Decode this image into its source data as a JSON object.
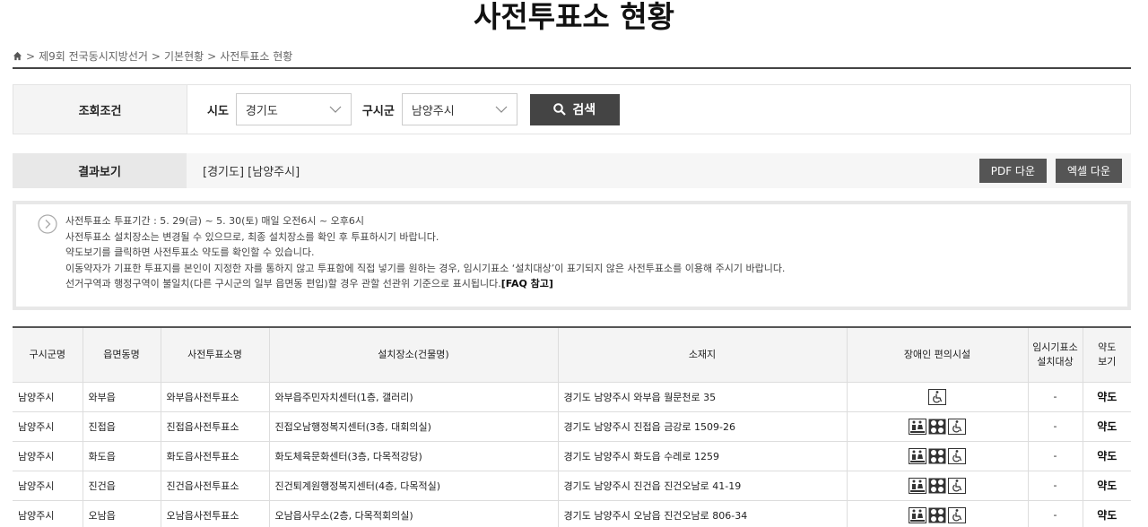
{
  "page": {
    "title": "사전투표소 현황"
  },
  "breadcrumb": {
    "items": [
      "제9회 전국동시지방선거",
      "기본현황",
      "사전투표소 현황"
    ],
    "separator": ">"
  },
  "search": {
    "label": "조회조건",
    "sido_label": "시도",
    "sido_value": "경기도",
    "gusigun_label": "구시군",
    "gusigun_value": "남양주시",
    "button_label": "검색"
  },
  "result": {
    "label": "결과보기",
    "text": "[경기도] [남양주시]",
    "pdf_label": "PDF 다운",
    "excel_label": "엑셀 다운"
  },
  "notice": {
    "line1": "사전투표소 투표기간 : 5. 29(금) ~ 5. 30(토) 매일 오전6시 ~ 오후6시",
    "line2": "사전투표소 설치장소는 변경될 수 있으므로, 최종 설치장소를 확인 후 투표하시기 바랍니다.",
    "line3": "약도보기를 클릭하면 사전투표소 약도를 확인할 수 있습니다.",
    "line4": "이동약자가 기표한 투표지를 본인이 지정한 자를 통하지 않고 투표함에 직접 넣기를 원하는 경우, 임시기표소 ‘설치대상’이 표기되지 않은 사전투표소를 이용해 주시기 바랍니다.",
    "line5": "선거구역과 행정구역이 불일치(다른 구시군의 일부 읍면동 편입)할 경우 관할 선관위 기준으로 표시됩니다.",
    "line5_link": "[FAQ 참고]"
  },
  "table": {
    "headers": {
      "gusigun": "구시군명",
      "eupmyeon": "읍면동명",
      "station": "사전투표소명",
      "place": "설치장소(건물명)",
      "address": "소재지",
      "facilities": "장애인 편의시설",
      "temp1": "임시기표소",
      "temp2": "설치대상",
      "map1": "약도",
      "map2": "보기"
    },
    "rows": [
      {
        "gusigun": "남양주시",
        "eupmyeon": "와부읍",
        "station": "와부읍사전투표소",
        "place": "와부읍주민자치센터(1층, 갤러리)",
        "address": "경기도 남양주시 와부읍 월문천로 35",
        "temp": "-",
        "map": "약도"
      },
      {
        "gusigun": "남양주시",
        "eupmyeon": "진접읍",
        "station": "진접읍사전투표소",
        "place": "진접오남행정복지센터(3층, 대회의실)",
        "address": "경기도 남양주시 진접읍 금강로 1509-26",
        "temp": "-",
        "map": "약도"
      },
      {
        "gusigun": "남양주시",
        "eupmyeon": "화도읍",
        "station": "화도읍사전투표소",
        "place": "화도체육문화센터(3층, 다목적강당)",
        "address": "경기도 남양주시 화도읍 수레로 1259",
        "temp": "-",
        "map": "약도"
      },
      {
        "gusigun": "남양주시",
        "eupmyeon": "진건읍",
        "station": "진건읍사전투표소",
        "place": "진건퇴계원행정복지센터(4층, 다목적실)",
        "address": "경기도 남양주시 진건읍 진건오남로 41-19",
        "temp": "-",
        "map": "약도"
      },
      {
        "gusigun": "남양주시",
        "eupmyeon": "오남읍",
        "station": "오남읍사전투표소",
        "place": "오남읍사무소(2층, 다목적회의실)",
        "address": "경기도 남양주시 오남읍 진건오남로 806-34",
        "temp": "-",
        "map": "약도"
      }
    ]
  },
  "icons": {
    "home": "home-icon",
    "chevron": "chevron-down-icon",
    "search": "search-icon",
    "notice": "circle-arrow-icon",
    "toilet": "accessible-toilet-icon",
    "elevator": "elevator-icon",
    "wheelchair": "wheelchair-icon"
  },
  "colors": {
    "button_dark": "#444444",
    "download_btn": "#555555",
    "header_bg": "#f4f4f4"
  }
}
